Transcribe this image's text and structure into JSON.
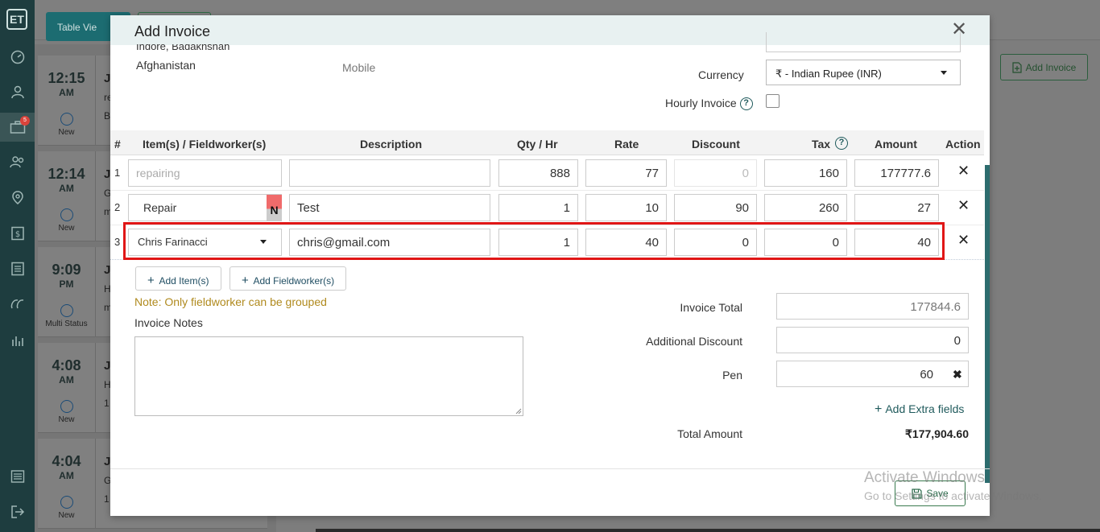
{
  "sidebar": {
    "logo": "ET",
    "badge_count": "5"
  },
  "background": {
    "table_view_label": "Table Vie",
    "add_invoice_label": "Add Invoice",
    "cards": [
      {
        "hour": "12:15",
        "ampm": "AM",
        "status": "New",
        "initial": "Ji",
        "line1": "re",
        "line2": "B"
      },
      {
        "hour": "12:14",
        "ampm": "AM",
        "status": "New",
        "initial": "Ji",
        "line1": "G",
        "line2": "m"
      },
      {
        "hour": "9:09",
        "ampm": "PM",
        "status": "Multi Status",
        "initial": "Ji",
        "line1": "H",
        "line2": "m"
      },
      {
        "hour": "4:08",
        "ampm": "AM",
        "status": "New",
        "initial": "Ji",
        "line1": "H",
        "line2": "1"
      },
      {
        "hour": "4:04",
        "ampm": "AM",
        "status": "New",
        "initial": "Ji",
        "line1": "G",
        "line2": "1"
      }
    ]
  },
  "modal": {
    "title": "Add Invoice",
    "address_line1": "Indore, Badakhshan",
    "address_line2": "Afghanistan",
    "mobile_label": "Mobile",
    "currency_label": "Currency",
    "currency_value": "₹ - Indian Rupee (INR)",
    "hourly_label": "Hourly Invoice",
    "hourly_checked": false,
    "columns": {
      "num": "#",
      "items": "Item(s) / Fieldworker(s)",
      "description": "Description",
      "qty": "Qty / Hr",
      "rate": "Rate",
      "discount": "Discount",
      "tax": "Tax",
      "amount": "Amount",
      "action": "Action"
    },
    "rows": [
      {
        "num": "1",
        "item": "repairing",
        "description": "",
        "qty": "888",
        "rate": "77",
        "discount": "0",
        "tax": "160",
        "amount": "177777.6"
      },
      {
        "num": "2",
        "item": "Repair",
        "badge": "N",
        "description": "Test",
        "qty": "1",
        "rate": "10",
        "discount": "90",
        "tax": "260",
        "amount": "27"
      },
      {
        "num": "3",
        "item": "Chris Farinacci",
        "description": "chris@gmail.com",
        "qty": "1",
        "rate": "40",
        "discount": "0",
        "tax": "0",
        "amount": "40"
      }
    ],
    "add_item_label": "Add Item(s)",
    "add_fieldworker_label": "Add Fieldworker(s)",
    "note": "Note: Only fieldworker can be grouped",
    "notes_label": "Invoice Notes",
    "notes_value": "",
    "invoice_total_label": "Invoice Total",
    "invoice_total_value": "177844.6",
    "additional_discount_label": "Additional Discount",
    "additional_discount_value": "0",
    "pen_label": "Pen",
    "pen_value": "60",
    "add_extra_label": "Add Extra fields",
    "total_amount_label": "Total Amount",
    "total_amount_value": "₹177,904.60",
    "save_label": "Save"
  },
  "watermark": {
    "line1": "Activate Windows",
    "line2": "Go to Settings to activate Windows."
  },
  "colors": {
    "accent": "#1f5a5c",
    "highlight": "#e01616",
    "note": "#b08a1e",
    "badge": "#f06b6b"
  }
}
